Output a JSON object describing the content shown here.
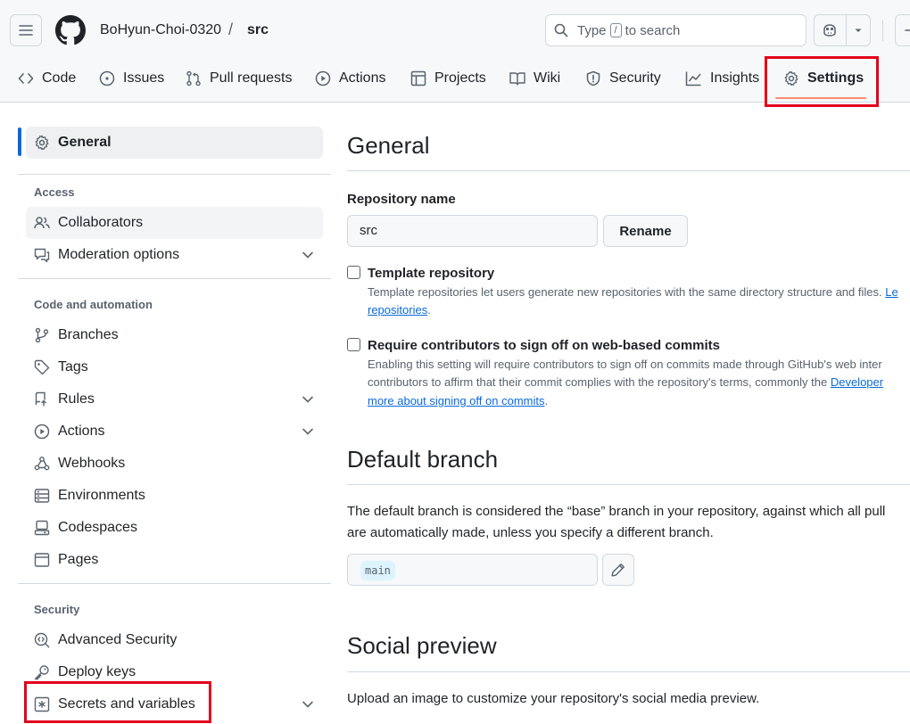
{
  "header": {
    "owner": "BoHyun-Choi-0320",
    "separator": "/",
    "repo": "src",
    "search": {
      "prefix": "Type",
      "key": "/",
      "suffix": "to search"
    }
  },
  "tabs": [
    {
      "label": "Code",
      "icon": "code-icon"
    },
    {
      "label": "Issues",
      "icon": "issue-icon"
    },
    {
      "label": "Pull requests",
      "icon": "pull-request-icon"
    },
    {
      "label": "Actions",
      "icon": "play-icon"
    },
    {
      "label": "Projects",
      "icon": "table-icon"
    },
    {
      "label": "Wiki",
      "icon": "book-icon"
    },
    {
      "label": "Security",
      "icon": "shield-icon"
    },
    {
      "label": "Insights",
      "icon": "graph-icon"
    },
    {
      "label": "Settings",
      "icon": "gear-icon",
      "active": true
    }
  ],
  "sidebar": {
    "general": "General",
    "access_title": "Access",
    "collaborators": "Collaborators",
    "moderation": "Moderation options",
    "code_automation_title": "Code and automation",
    "branches": "Branches",
    "tags": "Tags",
    "rules": "Rules",
    "actions": "Actions",
    "webhooks": "Webhooks",
    "environments": "Environments",
    "codespaces": "Codespaces",
    "pages": "Pages",
    "security_title": "Security",
    "advanced_security": "Advanced Security",
    "deploy_keys": "Deploy keys",
    "secrets": "Secrets and variables"
  },
  "main": {
    "general_title": "General",
    "repo_name_label": "Repository name",
    "repo_name_value": "src",
    "rename_button": "Rename",
    "template": {
      "title": "Template repository",
      "desc_line1_text": "Template repositories let users generate new repositories with the same directory structure and files.",
      "desc_line1_link": "Le",
      "desc_line2_link": "repositories",
      "desc_line2_end": "."
    },
    "signoff": {
      "title": "Require contributors to sign off on web-based commits",
      "desc_line1": "Enabling this setting will require contributors to sign off on commits made through GitHub's web inter",
      "desc_line2_text": "contributors to affirm that their commit complies with the repository's terms, commonly the",
      "desc_line2_link": "Developer",
      "desc_line3_link": "more about signing off on commits",
      "desc_line3_end": "."
    },
    "default_branch_title": "Default branch",
    "default_branch_desc_line1": "The default branch is considered the “base” branch in your repository, against which all pull",
    "default_branch_desc_line2": "are automatically made, unless you specify a different branch.",
    "default_branch_value": "main",
    "social_title": "Social preview",
    "social_desc": "Upload an image to customize your repository's social media preview."
  },
  "colors": {
    "accent": "#0969da",
    "highlight": "#e3001b",
    "tab_underline": "#fd8c73"
  }
}
